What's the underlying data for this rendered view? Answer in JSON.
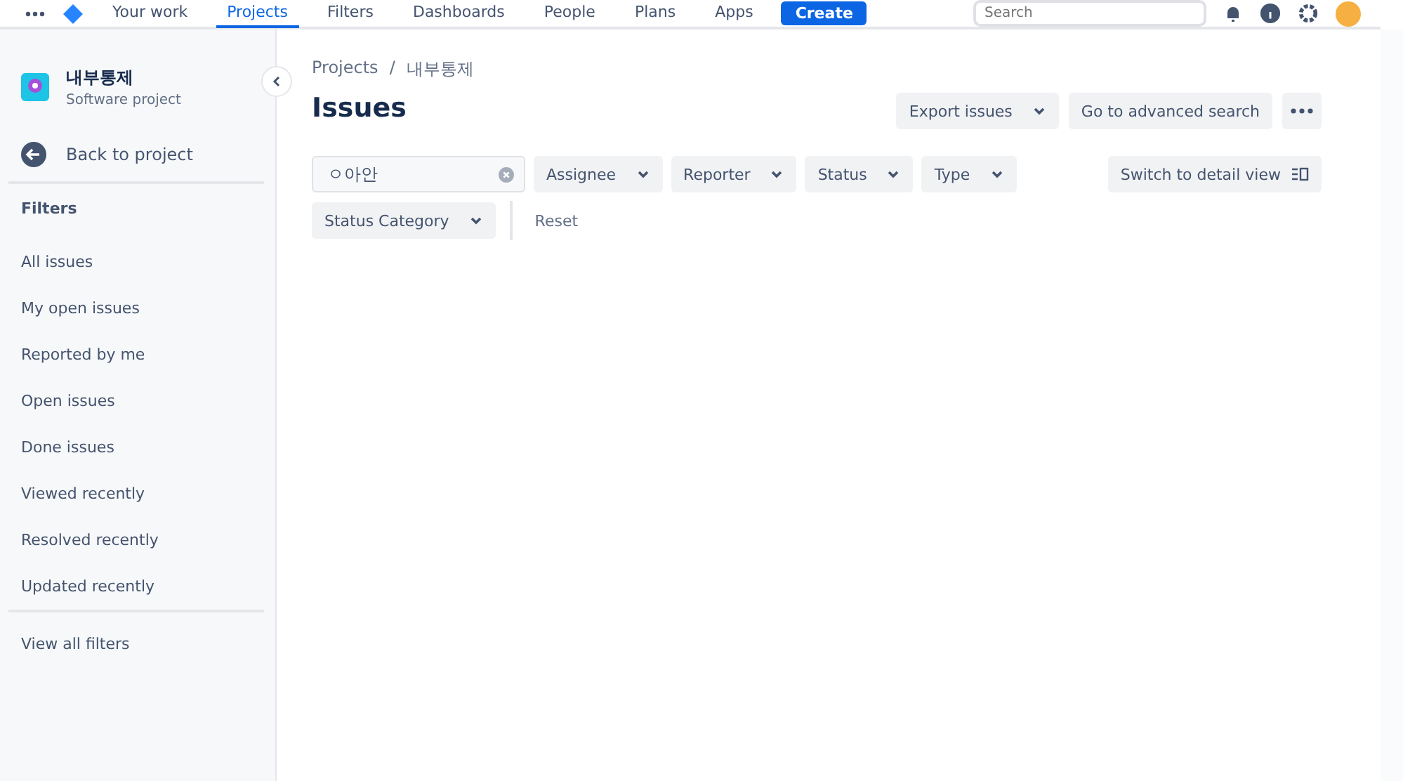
{
  "top_nav": {
    "items": [
      {
        "label": "Your work",
        "selected": false
      },
      {
        "label": "Projects",
        "selected": true
      },
      {
        "label": "Filters",
        "selected": false
      },
      {
        "label": "Dashboards",
        "selected": false
      },
      {
        "label": "People",
        "selected": false
      },
      {
        "label": "Plans",
        "selected": false
      },
      {
        "label": "Apps",
        "selected": false
      }
    ],
    "create_button": "Create",
    "search": {
      "placeholder": "Search"
    }
  },
  "sidebar": {
    "project_name": "내부통제",
    "project_type": "Software project",
    "back_link": "Back to project",
    "filters_heading": "Filters",
    "items": [
      {
        "label": "All issues",
        "selected": false
      },
      {
        "label": "My open issues",
        "selected": false
      },
      {
        "label": "Reported by me",
        "selected": false
      },
      {
        "label": "Open issues",
        "selected": false
      },
      {
        "label": "Done issues",
        "selected": false
      },
      {
        "label": "Viewed recently",
        "selected": false
      },
      {
        "label": "Resolved recently",
        "selected": false
      },
      {
        "label": "Updated recently",
        "selected": false
      }
    ],
    "view_all": "View all filters"
  },
  "breadcrumbs": [
    "Projects",
    "내부통제"
  ],
  "breadcrumb_separator": "/",
  "title": "Issues",
  "header_buttons": [
    {
      "label": "Export issues",
      "kind": "dropdown"
    },
    {
      "label": "Go to advanced search",
      "kind": "plain"
    }
  ],
  "search_field": {
    "value": "ㅇ아안"
  },
  "filters": [
    {
      "label": "Assignee"
    },
    {
      "label": "Reporter"
    },
    {
      "label": "Status"
    },
    {
      "label": "Type"
    },
    {
      "label": "Status Category"
    }
  ],
  "reset": "Reset",
  "detail_view_button": "Switch to detail view"
}
